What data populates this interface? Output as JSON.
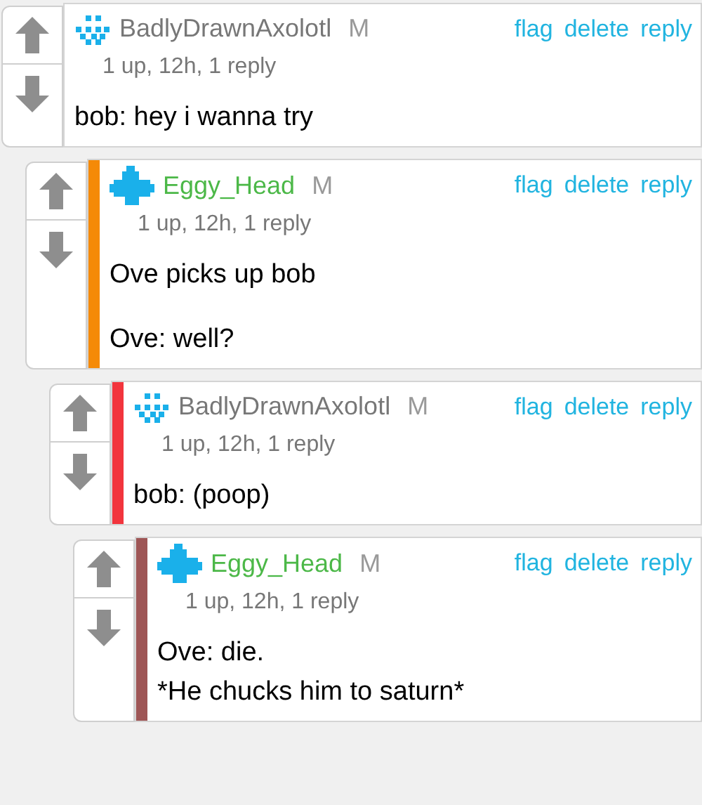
{
  "comments": [
    {
      "kind": "dots",
      "username": "BadlyDrawnAxolotl",
      "badge": "M",
      "meta": "1 up, 12h, 1 reply",
      "actions": [
        "flag",
        "delete",
        "reply"
      ],
      "paragraphs": [
        [
          "bob: hey i wanna try"
        ]
      ]
    },
    {
      "kind": "cross",
      "color": "#f58a07",
      "username": "Eggy_Head",
      "badge": "M",
      "meta": "1 up, 12h, 1 reply",
      "actions": [
        "flag",
        "delete",
        "reply"
      ],
      "paragraphs": [
        [
          "Ove picks up bob"
        ],
        [
          "Ove: well?"
        ]
      ]
    },
    {
      "kind": "dots",
      "color": "#f2353d",
      "username": "BadlyDrawnAxolotl",
      "badge": "M",
      "meta": "1 up, 12h, 1 reply",
      "actions": [
        "flag",
        "delete",
        "reply"
      ],
      "paragraphs": [
        [
          "bob: (poop)"
        ]
      ]
    },
    {
      "kind": "cross",
      "color": "#9e5656",
      "username": "Eggy_Head",
      "badge": "M",
      "meta": "1 up, 12h, 1 reply",
      "actions": [
        "flag",
        "delete",
        "reply"
      ],
      "paragraphs": [
        [
          "Ove: die.",
          "*He chucks him to saturn*"
        ]
      ]
    }
  ]
}
